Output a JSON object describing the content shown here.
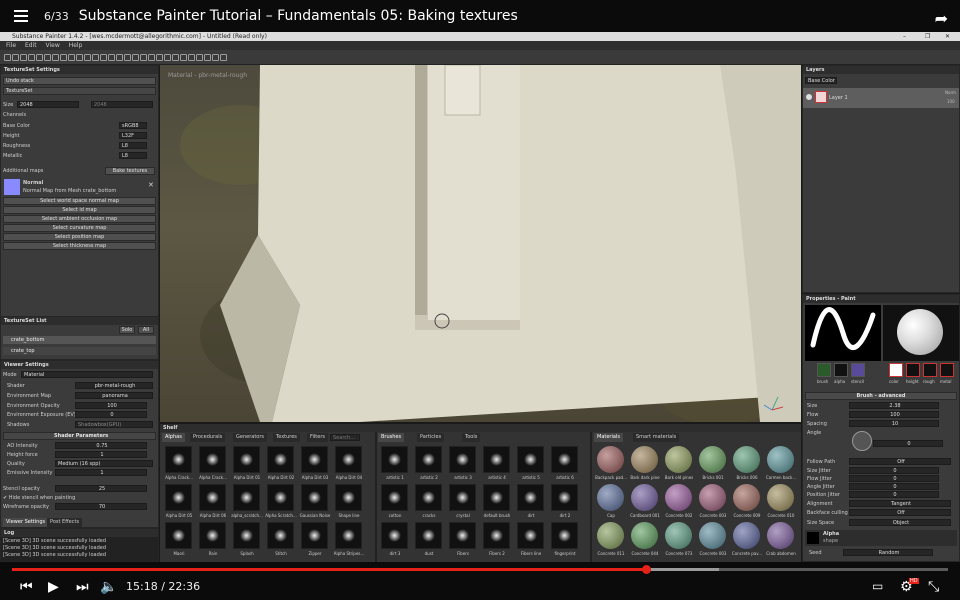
{
  "player": {
    "video_count": "6/33",
    "title": "Substance Painter Tutorial – Fundamentals 05: Baking textures",
    "time": "15:18 / 22:36",
    "progress": 0.677,
    "buffered": 0.755,
    "hd_badge": "HD"
  },
  "app": {
    "window_title": "Substance Painter 1.4.2 - [wes.mcdermott@allegorithmic.com] - Untitled (Read only)",
    "menu": [
      "File",
      "Edit",
      "View",
      "Help"
    ],
    "viewport_label": "Material - pbr-metal-rough"
  },
  "textureset_settings": {
    "title": "TextureSet Settings",
    "undo": "Undo stack",
    "textureset": "TextureSet",
    "size_label": "Size",
    "size_value": "2048",
    "size_value2": "2048",
    "channels_label": "Channels",
    "channels": [
      {
        "name": "Base Color",
        "fmt": "sRGB8"
      },
      {
        "name": "Height",
        "fmt": "L32F"
      },
      {
        "name": "Roughness",
        "fmt": "L8"
      },
      {
        "name": "Metallic",
        "fmt": "L8"
      }
    ],
    "additional_maps": "Additional maps",
    "bake_button": "Bake textures",
    "normal_title": "Normal",
    "normal_desc": "Normal Map from Mesh crate_bottom",
    "map_buttons": [
      "Select world space normal map",
      "Select id map",
      "Select ambient occlusion map",
      "Select curvature map",
      "Select position map",
      "Select thickness map"
    ]
  },
  "textureset_list": {
    "title": "TextureSet List",
    "solo": "Solo",
    "all": "All",
    "items": [
      "crate_bottom",
      "crate_top"
    ]
  },
  "viewer_settings": {
    "title": "Viewer Settings",
    "mode_label": "Mode",
    "mode_value": "Material",
    "shader_label": "Shader",
    "shader_value": "pbr-metal-rough",
    "envmap_label": "Environment Map",
    "envmap_value": "panorama",
    "env_opacity_label": "Environment Opacity",
    "env_opacity_value": "100",
    "env_exposure_label": "Environment Exposure (EV)",
    "env_exposure_value": "0",
    "shadows_label": "Shadows",
    "shadows_value": "Shadowbox(GPU)",
    "shader_params": "Shader Parameters",
    "ao_label": "AO Intensity",
    "ao_value": "0.75",
    "height_label": "Height force",
    "height_value": "1",
    "quality_label": "Quality",
    "quality_value": "Medium (16 spp)",
    "emissive_label": "Emissive Intensity",
    "emissive_value": "1",
    "stencil_label": "Stencil opacity",
    "stencil_value": "25",
    "hide_stencil": "Hide stencil when painting",
    "wire_label": "Wireframe opacity",
    "wire_value": "70",
    "tab1": "Viewer Settings",
    "tab2": "Post Effects"
  },
  "log": {
    "title": "Log",
    "lines": [
      "[Scene 3D] 3D scene successfully loaded",
      "[Scene 3D] 3D scene successfully loaded",
      "[Scene 3D] 3D scene successfully loaded"
    ]
  },
  "shelf": {
    "title": "Shelf",
    "tabs": [
      "Alphas",
      "Procedurals",
      "Generators",
      "Textures",
      "Filters"
    ],
    "search": "Search...",
    "alphas": [
      "Alpha Crack...",
      "Alpha Crack...",
      "Alpha Dirt 01",
      "Alpha Dirt 02",
      "Alpha Dirt 03",
      "Alpha Dirt 04",
      "Alpha Dirt 05",
      "Alpha Dirt 06",
      "alpha_scratch...",
      "Alpha Scratch...",
      "Gaussian Noise",
      "Shape line",
      "Maori",
      "Rain",
      "Splash",
      "Stitch",
      "Zipper",
      "Alpha Stripes..."
    ],
    "brushes_tabs": [
      "Brushes",
      "Particles",
      "Tools"
    ],
    "brushes": [
      "artistic 1",
      "artistic 2",
      "artistic 3",
      "artistic 4",
      "artistic 5",
      "artistic 6",
      "cotton",
      "cracks",
      "crystal",
      "default brush",
      "dirt",
      "dirt 2",
      "dirt 3",
      "dust",
      "Fibers",
      "Fibers 2",
      "Fibers line",
      "fingerprint"
    ],
    "materials_tabs": [
      "Materials",
      "Smart materials"
    ],
    "materials": [
      "Backpack pad...",
      "Bark dark pine",
      "Bark old pines",
      "Bricks 001",
      "Bricks 006",
      "Carmen back...",
      "Cap",
      "Cardboard 001",
      "Concrete 002",
      "Concrete 003",
      "Concrete 009",
      "Concrete 010",
      "Concrete 011",
      "Concrete 044",
      "Concrete 073",
      "Concrete 003",
      "Concrete pav...",
      "Crab abdomen"
    ]
  },
  "layers": {
    "title": "Layers",
    "channel": "Base Color",
    "layer_name": "Layer 1",
    "blend": "Norm",
    "opacity": "100"
  },
  "properties": {
    "title": "Properties - Paint",
    "chan_labels": [
      "brush",
      "alpha",
      "stencil"
    ],
    "mat_labels": [
      "color",
      "height",
      "rough",
      "metal"
    ],
    "brush_adv": "Brush - advanced",
    "rows": [
      {
        "k": "Size",
        "v": "2.38"
      },
      {
        "k": "Flow",
        "v": "100"
      },
      {
        "k": "Spacing",
        "v": "10"
      },
      {
        "k": "Angle",
        "v": "0"
      }
    ],
    "follow_label": "Follow Path",
    "follow_value": "Off",
    "jitters": [
      {
        "k": "Size Jitter",
        "v": "0"
      },
      {
        "k": "Flow Jitter",
        "v": "0"
      },
      {
        "k": "Angle Jitter",
        "v": "0"
      },
      {
        "k": "Position Jitter",
        "v": "0"
      }
    ],
    "alignment_label": "Alignment",
    "alignment_value": "Tangent",
    "backface_label": "Backface culling",
    "backface_value": "Off",
    "space_label": "Size Space",
    "space_value": "Object",
    "alpha_title": "Alpha",
    "alpha_shape": "shape",
    "seed_label": "Seed",
    "seed_value": "Random"
  },
  "colors": {
    "accent": "#e62117",
    "panel": "#3b3b3b",
    "header": "#2d2d2d"
  }
}
